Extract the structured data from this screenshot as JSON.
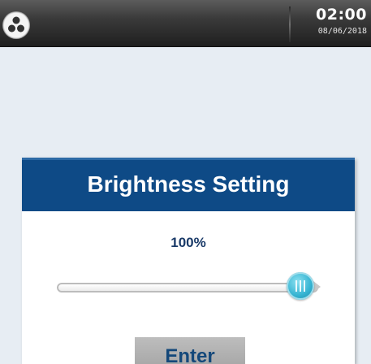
{
  "status_bar": {
    "home_icon": "home-dots-icon",
    "time": "02:00",
    "date": "08/06/2018"
  },
  "dialog": {
    "title": "Brightness Setting",
    "value_label": "100%",
    "brightness_fraction": 1.0,
    "enter_label": "Enter"
  },
  "colors": {
    "header": "#0e4a86",
    "accent": "#36b4d2",
    "value_text": "#1a3a68",
    "button": "#b4b4b4"
  }
}
